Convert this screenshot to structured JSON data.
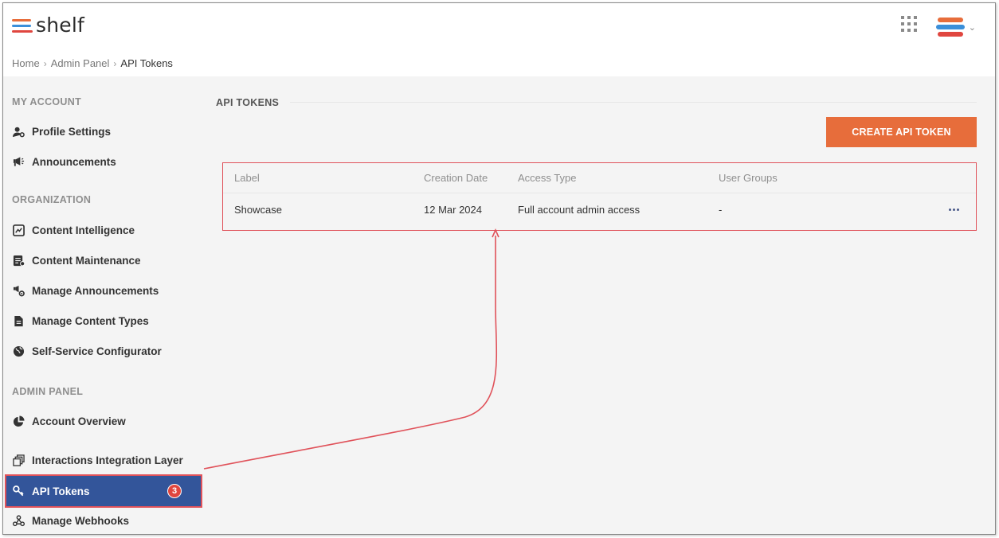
{
  "app": {
    "logo_text": "shelf"
  },
  "breadcrumb": {
    "items": [
      "Home",
      "Admin Panel",
      "API Tokens"
    ],
    "separator": "›"
  },
  "sidebar": {
    "sections": [
      {
        "title": "MY ACCOUNT",
        "items": [
          "Profile Settings",
          "Announcements"
        ]
      },
      {
        "title": "ORGANIZATION",
        "items": [
          "Content Intelligence",
          "Content Maintenance",
          "Manage Announcements",
          "Manage Content Types",
          "Self-Service Configurator"
        ]
      },
      {
        "title": "ADMIN PANEL",
        "items": [
          "Account Overview",
          "Interactions Integration Layer",
          "API Tokens",
          "Manage Webhooks"
        ]
      }
    ],
    "active_item": "API Tokens",
    "step_badge": "3"
  },
  "main": {
    "title": "API TOKENS",
    "create_button": "CREATE API TOKEN",
    "table": {
      "columns": [
        "Label",
        "Creation Date",
        "Access Type",
        "User Groups"
      ],
      "rows": [
        {
          "label": "Showcase",
          "creation_date": "12 Mar 2024",
          "access_type": "Full account admin access",
          "user_groups": "-"
        }
      ]
    }
  },
  "colors": {
    "accent_orange": "#e76d3b",
    "active_nav": "#33559a",
    "highlight_red": "#e0525a",
    "logo_lines": [
      "#e76d3b",
      "#3b8fd9",
      "#e0463f"
    ]
  },
  "icons": [
    "apps-grid-icon",
    "shelf-brand-icon",
    "chevron-down-icon",
    "more-horizontal-icon"
  ]
}
